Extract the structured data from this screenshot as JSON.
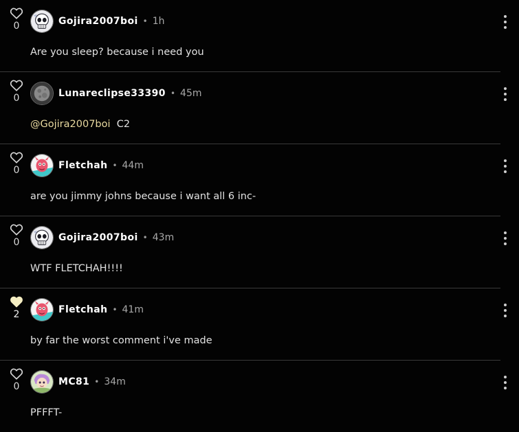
{
  "comments": [
    {
      "likes": "0",
      "liked": false,
      "username": "Gojira2007boi",
      "time": "1h",
      "mention": "",
      "text": "Are you sleep? because i need you",
      "avatar": "skull-avatar"
    },
    {
      "likes": "0",
      "liked": false,
      "username": "Lunareclipse33390",
      "time": "45m",
      "mention": "@Gojira2007boi",
      "text": "  C2",
      "avatar": "moon-avatar"
    },
    {
      "likes": "0",
      "liked": false,
      "username": "Fletchah",
      "time": "44m",
      "mention": "",
      "text": "are you jimmy johns because i want all 6 inc-",
      "avatar": "dragon-avatar"
    },
    {
      "likes": "0",
      "liked": false,
      "username": "Gojira2007boi",
      "time": "43m",
      "mention": "",
      "text": "WTF FLETCHAH!!!!",
      "avatar": "skull-avatar"
    },
    {
      "likes": "2",
      "liked": true,
      "username": "Fletchah",
      "time": "41m",
      "mention": "",
      "text": "by far the worst comment i've made",
      "avatar": "dragon-avatar"
    },
    {
      "likes": "0",
      "liked": false,
      "username": "MC81",
      "time": "34m",
      "mention": "",
      "text": "PFFFT-",
      "avatar": "character-avatar"
    }
  ],
  "separator": "•",
  "colors": {
    "background": "#030303",
    "liked_heart": "#f5eec2",
    "mention": "#e8d9a0",
    "divider": "#3a3a3a"
  }
}
